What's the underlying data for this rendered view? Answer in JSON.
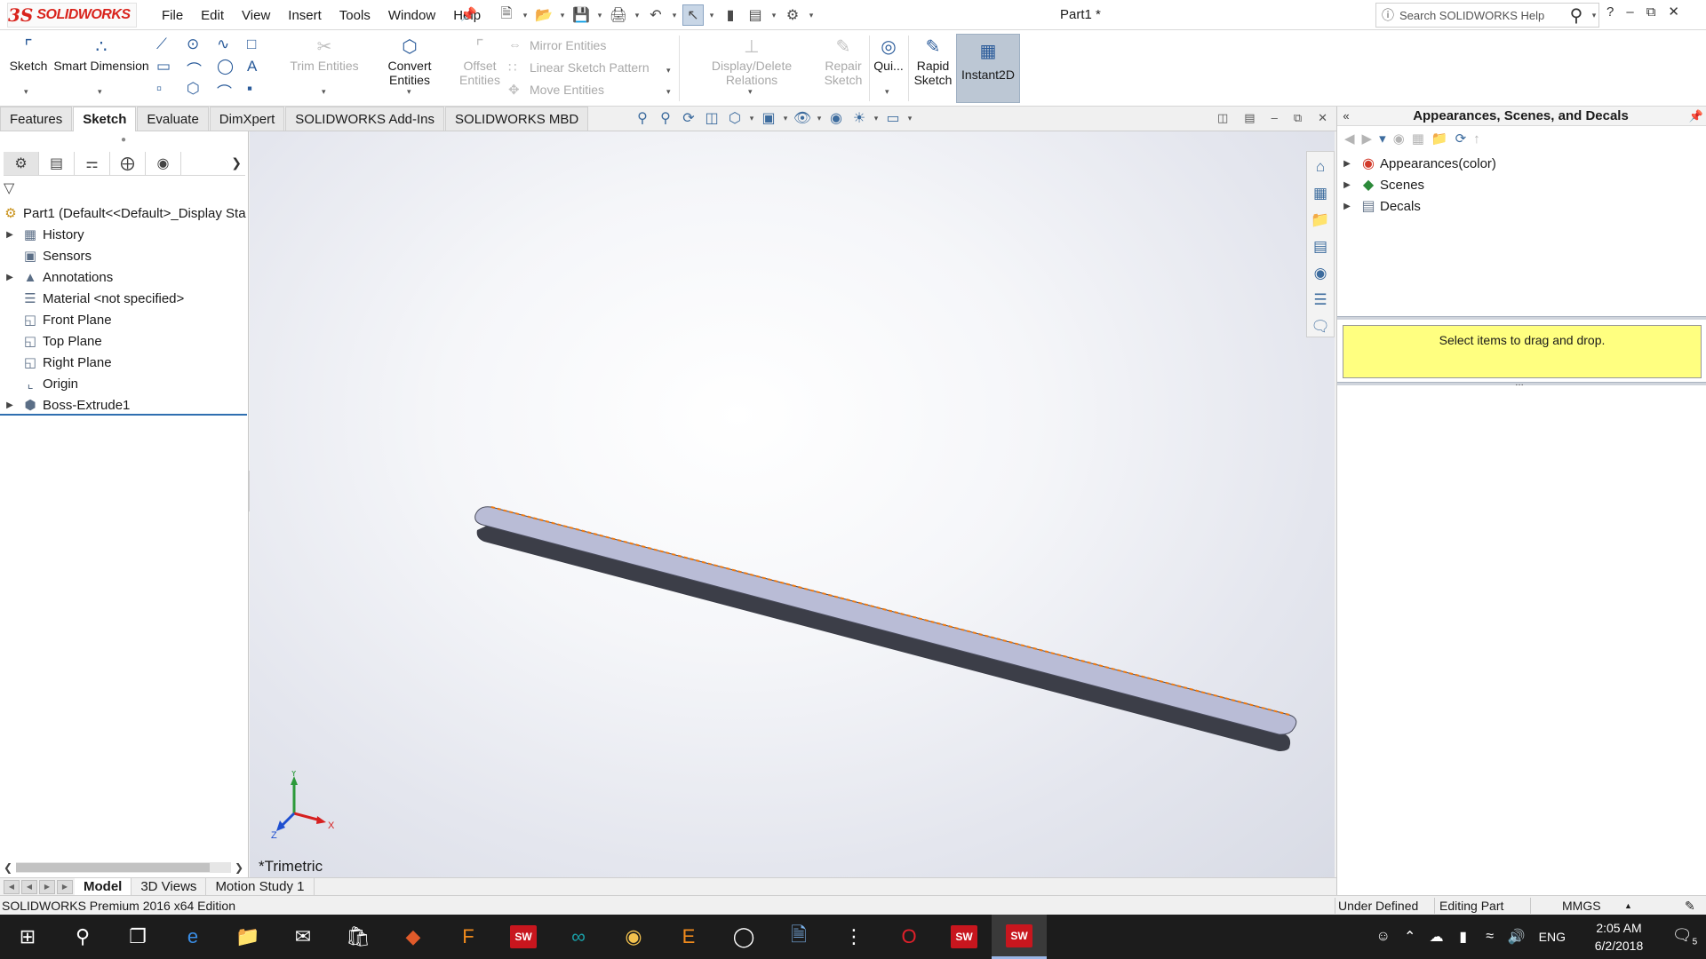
{
  "app": {
    "brand_mark": "3S",
    "brand_name": "SOLIDWORKS",
    "doc_title": "Part1 *",
    "brand_color": "#d9231c",
    "accent_color": "#2f6fb0"
  },
  "menu": {
    "items": [
      "File",
      "Edit",
      "View",
      "Insert",
      "Tools",
      "Window",
      "Help"
    ]
  },
  "search": {
    "placeholder": "Search SOLIDWORKS Help"
  },
  "window_controls": {
    "help": "?",
    "minimize": "–",
    "restore": "⧉",
    "close": "✕"
  },
  "ribbon": {
    "sketch": "Sketch",
    "smart_dimension": "Smart Dimension",
    "trim_entities": "Trim Entities",
    "convert_entities": "Convert Entities",
    "offset_entities_line1": "Offset",
    "offset_entities_line2": "Entities",
    "mirror_entities": "Mirror Entities",
    "linear_sketch_pattern": "Linear Sketch Pattern",
    "move_entities": "Move Entities",
    "display_delete_relations": "Display/Delete Relations",
    "repair_sketch_line1": "Repair",
    "repair_sketch_line2": "Sketch",
    "quick_snaps": "Qui...",
    "rapid_sketch_line1": "Rapid",
    "rapid_sketch_line2": "Sketch",
    "instant2d": "Instant2D"
  },
  "tabs": [
    "Features",
    "Sketch",
    "Evaluate",
    "DimXpert",
    "SOLIDWORKS Add-Ins",
    "SOLIDWORKS MBD"
  ],
  "active_tab": "Sketch",
  "feature_tree": {
    "root": "Part1  (Default<<Default>_Display Sta",
    "items": [
      {
        "label": "History",
        "icon": "history-icon",
        "expandable": true
      },
      {
        "label": "Sensors",
        "icon": "sensors-icon",
        "expandable": false
      },
      {
        "label": "Annotations",
        "icon": "annotations-icon",
        "expandable": true
      },
      {
        "label": "Material <not specified>",
        "icon": "material-icon",
        "expandable": false
      },
      {
        "label": "Front Plane",
        "icon": "plane-icon",
        "expandable": false
      },
      {
        "label": "Top Plane",
        "icon": "plane-icon",
        "expandable": false
      },
      {
        "label": "Right Plane",
        "icon": "plane-icon",
        "expandable": false
      },
      {
        "label": "Origin",
        "icon": "origin-icon",
        "expandable": false
      },
      {
        "label": "Boss-Extrude1",
        "icon": "extrude-icon",
        "expandable": true
      }
    ]
  },
  "graphics": {
    "view_orientation": "*Trimetric",
    "triad": {
      "x": "X",
      "y": "Y",
      "z": "Z"
    }
  },
  "task_pane": {
    "title": "Appearances, Scenes, and Decals",
    "items": [
      {
        "label": "Appearances(color)",
        "icon": "appearances-icon"
      },
      {
        "label": "Scenes",
        "icon": "scenes-icon"
      },
      {
        "label": "Decals",
        "icon": "decals-icon"
      }
    ],
    "hint": "Select items to drag and drop.",
    "hint_color": "#ffff80"
  },
  "bottom_tabs": [
    "Model",
    "3D Views",
    "Motion Study 1"
  ],
  "active_bottom_tab": "Model",
  "status": {
    "edition": "SOLIDWORKS Premium 2016 x64 Edition",
    "definition": "Under Defined",
    "mode": "Editing Part",
    "units": "MMGS"
  },
  "taskbar": {
    "sw2016": "SW",
    "sw2017": "SW",
    "language": "ENG",
    "time": "2:05 AM",
    "date": "6/2/2018",
    "notifications": "5"
  }
}
